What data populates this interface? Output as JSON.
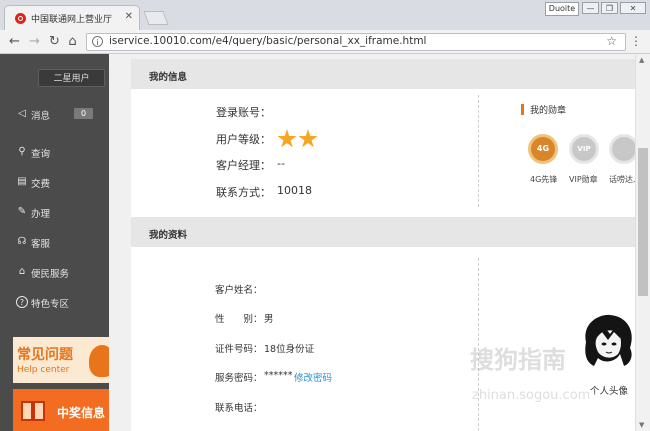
{
  "browser": {
    "tab_title": "中国联通网上营业厅",
    "tab_close": "✕",
    "profile_chip": "Duoite",
    "url": "iservice.10010.com/e4/query/basic/personal_xx_iframe.html",
    "window_buttons": [
      "—",
      "❐",
      "✕"
    ]
  },
  "sidebar": {
    "star_user": "二星用户",
    "items": [
      {
        "label": "消息",
        "icon": "megaphone-icon",
        "glyph": "◁",
        "badge": "0"
      },
      {
        "label": "查询",
        "icon": "search-icon",
        "glyph": "⚲"
      },
      {
        "label": "交费",
        "icon": "bill-icon",
        "glyph": "▤"
      },
      {
        "label": "办理",
        "icon": "pen-icon",
        "glyph": "✎"
      },
      {
        "label": "客服",
        "icon": "headset-icon",
        "glyph": "☊"
      },
      {
        "label": "便民服务",
        "icon": "home-icon",
        "glyph": "⌂"
      },
      {
        "label": "特色专区",
        "icon": "help-circle-icon",
        "glyph": "?"
      }
    ],
    "banners": {
      "help_title": "常见问题",
      "help_sub": "Help center",
      "prize_title": "中奖信息"
    }
  },
  "info": {
    "header": "我的信息",
    "account_label": "登录账号：",
    "level_label": "用户等级：",
    "stars": 2,
    "manager_label": "客户经理：",
    "manager_value": "--",
    "contact_label": "联系方式：",
    "contact_value": "10018"
  },
  "medals": {
    "title": "我的勋章",
    "items": [
      "4G先锋",
      "VIP勋章",
      "话唠达人"
    ]
  },
  "profile": {
    "header": "我的资料",
    "name_label": "客户姓名：",
    "gender_label": "性　　别：",
    "gender_value": "男",
    "id_label": "证件号码：",
    "id_value": "18位身份证",
    "password_label": "服务密码：",
    "password_value": "******",
    "change_password": "修改密码",
    "phone_label": "联系电话：",
    "avatar_label": "个人头像"
  },
  "watermark": {
    "text": "搜狗指南",
    "url": "zhinan.sogou.com"
  },
  "colors": {
    "accent": "#e8741c",
    "star": "#f6a623",
    "link": "#2a8fd0",
    "sidebar": "#4b4b4b"
  }
}
